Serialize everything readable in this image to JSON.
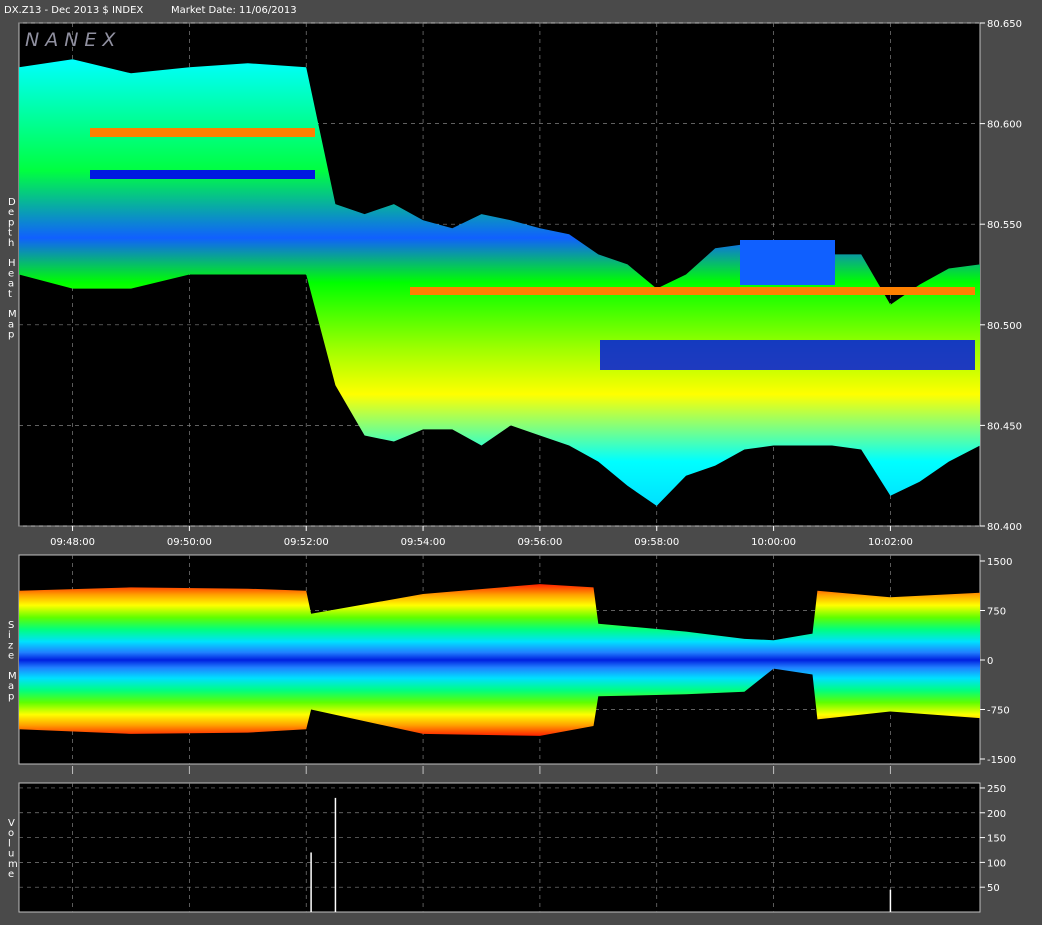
{
  "header": {
    "symbol": "DX.Z13 - Dec 2013 $ INDEX",
    "market_date": "Market Date: 11/06/2013"
  },
  "watermark": "NANEX",
  "colors": {
    "background": "#000000",
    "frame": "#4a4a4a",
    "grid": "#808080",
    "axis_text": "#ffffff",
    "heat_scale": [
      "#0018e0",
      "#1060ff",
      "#20a0ff",
      "#00ffff",
      "#00ff00",
      "#a0ff00",
      "#ffff00",
      "#ff8000",
      "#ff0000",
      "#ffffff"
    ]
  },
  "chart_data": [
    {
      "type": "heatmap",
      "name": "depth-heat-map",
      "ylabel": "Depth Heat Map",
      "y_ticks": [
        "80.650",
        "80.600",
        "80.550",
        "80.500",
        "80.450",
        "80.400"
      ],
      "ylim": [
        80.4,
        80.65
      ],
      "x_ticks": [
        "09:48:00",
        "09:50:00",
        "09:52:00",
        "09:54:00",
        "09:56:00",
        "09:58:00",
        "10:00:00",
        "10:02:00"
      ],
      "xlim": [
        "09:47:05",
        "10:03:32"
      ],
      "grid": true,
      "price_band": [
        {
          "time": "09:47:05",
          "low": 80.525,
          "high": 80.628
        },
        {
          "time": "09:48:00",
          "low": 80.518,
          "high": 80.632
        },
        {
          "time": "09:49:00",
          "low": 80.518,
          "high": 80.625
        },
        {
          "time": "09:50:00",
          "low": 80.525,
          "high": 80.628
        },
        {
          "time": "09:51:00",
          "low": 80.525,
          "high": 80.63
        },
        {
          "time": "09:52:00",
          "low": 80.525,
          "high": 80.628
        },
        {
          "time": "09:52:30",
          "low": 80.47,
          "high": 80.56
        },
        {
          "time": "09:53:00",
          "low": 80.445,
          "high": 80.555
        },
        {
          "time": "09:53:30",
          "low": 80.442,
          "high": 80.56
        },
        {
          "time": "09:54:00",
          "low": 80.448,
          "high": 80.552
        },
        {
          "time": "09:54:30",
          "low": 80.448,
          "high": 80.548
        },
        {
          "time": "09:55:00",
          "low": 80.44,
          "high": 80.555
        },
        {
          "time": "09:55:30",
          "low": 80.45,
          "high": 80.552
        },
        {
          "time": "09:56:00",
          "low": 80.445,
          "high": 80.548
        },
        {
          "time": "09:56:30",
          "low": 80.44,
          "high": 80.545
        },
        {
          "time": "09:57:00",
          "low": 80.432,
          "high": 80.535
        },
        {
          "time": "09:57:30",
          "low": 80.42,
          "high": 80.53
        },
        {
          "time": "09:58:00",
          "low": 80.41,
          "high": 80.518
        },
        {
          "time": "09:58:30",
          "low": 80.425,
          "high": 80.525
        },
        {
          "time": "09:59:00",
          "low": 80.43,
          "high": 80.538
        },
        {
          "time": "09:59:30",
          "low": 80.438,
          "high": 80.54
        },
        {
          "time": "10:00:00",
          "low": 80.44,
          "high": 80.54
        },
        {
          "time": "10:00:30",
          "low": 80.44,
          "high": 80.538
        },
        {
          "time": "10:01:00",
          "low": 80.44,
          "high": 80.535
        },
        {
          "time": "10:01:30",
          "low": 80.438,
          "high": 80.535
        },
        {
          "time": "10:02:00",
          "low": 80.415,
          "high": 80.51
        },
        {
          "time": "10:02:30",
          "low": 80.422,
          "high": 80.52
        },
        {
          "time": "10:03:00",
          "low": 80.432,
          "high": 80.528
        },
        {
          "time": "10:03:32",
          "low": 80.44,
          "high": 80.53
        }
      ]
    },
    {
      "type": "area",
      "name": "size-map",
      "ylabel": "Size Map",
      "y_ticks": [
        "1500",
        "750",
        "0",
        "-750",
        "-1500"
      ],
      "ylim": [
        -1500,
        1500
      ],
      "grid": true,
      "envelope": [
        {
          "time": "09:47:05",
          "upper": 1050,
          "lower": -1050
        },
        {
          "time": "09:49:00",
          "upper": 1100,
          "lower": -1120
        },
        {
          "time": "09:51:00",
          "upper": 1080,
          "lower": -1100
        },
        {
          "time": "09:52:00",
          "upper": 1050,
          "lower": -1050
        },
        {
          "time": "09:52:05",
          "upper": 700,
          "lower": -750
        },
        {
          "time": "09:54:00",
          "upper": 1000,
          "lower": -1120
        },
        {
          "time": "09:56:00",
          "upper": 1150,
          "lower": -1150
        },
        {
          "time": "09:56:55",
          "upper": 1100,
          "lower": -1000
        },
        {
          "time": "09:57:00",
          "upper": 550,
          "lower": -550
        },
        {
          "time": "09:58:30",
          "upper": 430,
          "lower": -520
        },
        {
          "time": "09:59:30",
          "upper": 320,
          "lower": -480
        },
        {
          "time": "10:00:00",
          "upper": 300,
          "lower": -130
        },
        {
          "time": "10:00:40",
          "upper": 400,
          "lower": -220
        },
        {
          "time": "10:00:45",
          "upper": 1050,
          "lower": -900
        },
        {
          "time": "10:02:00",
          "upper": 950,
          "lower": -780
        },
        {
          "time": "10:03:32",
          "upper": 1020,
          "lower": -880
        }
      ]
    },
    {
      "type": "bar",
      "name": "volume",
      "ylabel": "Volume",
      "y_ticks": [
        "250",
        "200",
        "150",
        "100",
        "50"
      ],
      "ylim": [
        0,
        260
      ],
      "grid": true,
      "notable_bars": [
        {
          "time": "09:52:05",
          "value": 120
        },
        {
          "time": "09:52:30",
          "value": 230
        },
        {
          "time": "10:02:00",
          "value": 45
        }
      ]
    }
  ]
}
